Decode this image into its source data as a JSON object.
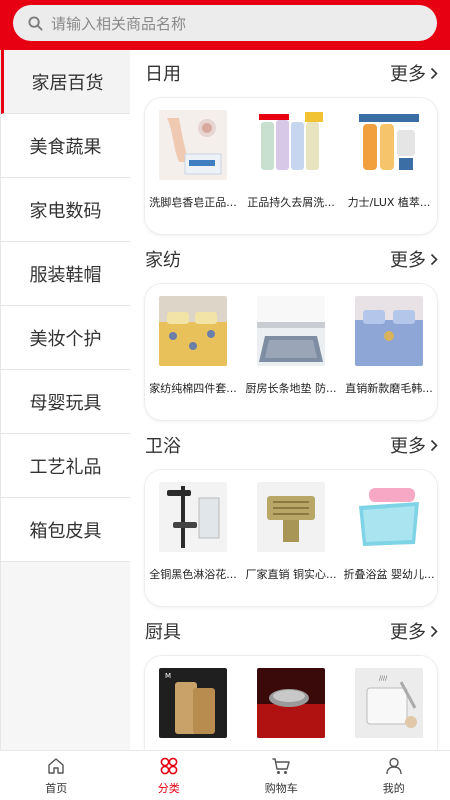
{
  "search": {
    "placeholder": "请输入相关商品名称"
  },
  "sidebar": {
    "items": [
      {
        "label": "家居百货",
        "active": true
      },
      {
        "label": "美食蔬果",
        "active": false
      },
      {
        "label": "家电数码",
        "active": false
      },
      {
        "label": "服装鞋帽",
        "active": false
      },
      {
        "label": "美妆个护",
        "active": false
      },
      {
        "label": "母婴玩具",
        "active": false
      },
      {
        "label": "工艺礼品",
        "active": false
      },
      {
        "label": "箱包皮具",
        "active": false
      }
    ]
  },
  "sections": [
    {
      "title": "日用",
      "more": "更多",
      "products": [
        {
          "name": "洗脚皂香皂正品..."
        },
        {
          "name": "正品持久去屑洗..."
        },
        {
          "name": "力士/LUX 植萃..."
        }
      ]
    },
    {
      "title": "家纺",
      "more": "更多",
      "products": [
        {
          "name": "家纺纯棉四件套..."
        },
        {
          "name": "厨房长条地垫 防..."
        },
        {
          "name": "直销新款磨毛韩..."
        }
      ]
    },
    {
      "title": "卫浴",
      "more": "更多",
      "products": [
        {
          "name": "全铜黑色淋浴花..."
        },
        {
          "name": "厂家直销 铜实心..."
        },
        {
          "name": "折叠浴盆 婴幼儿..."
        }
      ]
    },
    {
      "title": "厨具",
      "more": "更多",
      "products": [
        {
          "name": ""
        },
        {
          "name": ""
        },
        {
          "name": ""
        }
      ]
    }
  ],
  "tabbar": {
    "items": [
      {
        "label": "首页",
        "icon": "home-icon",
        "active": false
      },
      {
        "label": "分类",
        "icon": "category-icon",
        "active": true
      },
      {
        "label": "购物车",
        "icon": "cart-icon",
        "active": false
      },
      {
        "label": "我的",
        "icon": "user-icon",
        "active": false
      }
    ]
  },
  "colors": {
    "brand": "#e60012",
    "sidebar_bg": "#f6f6f6",
    "text": "#333333"
  }
}
